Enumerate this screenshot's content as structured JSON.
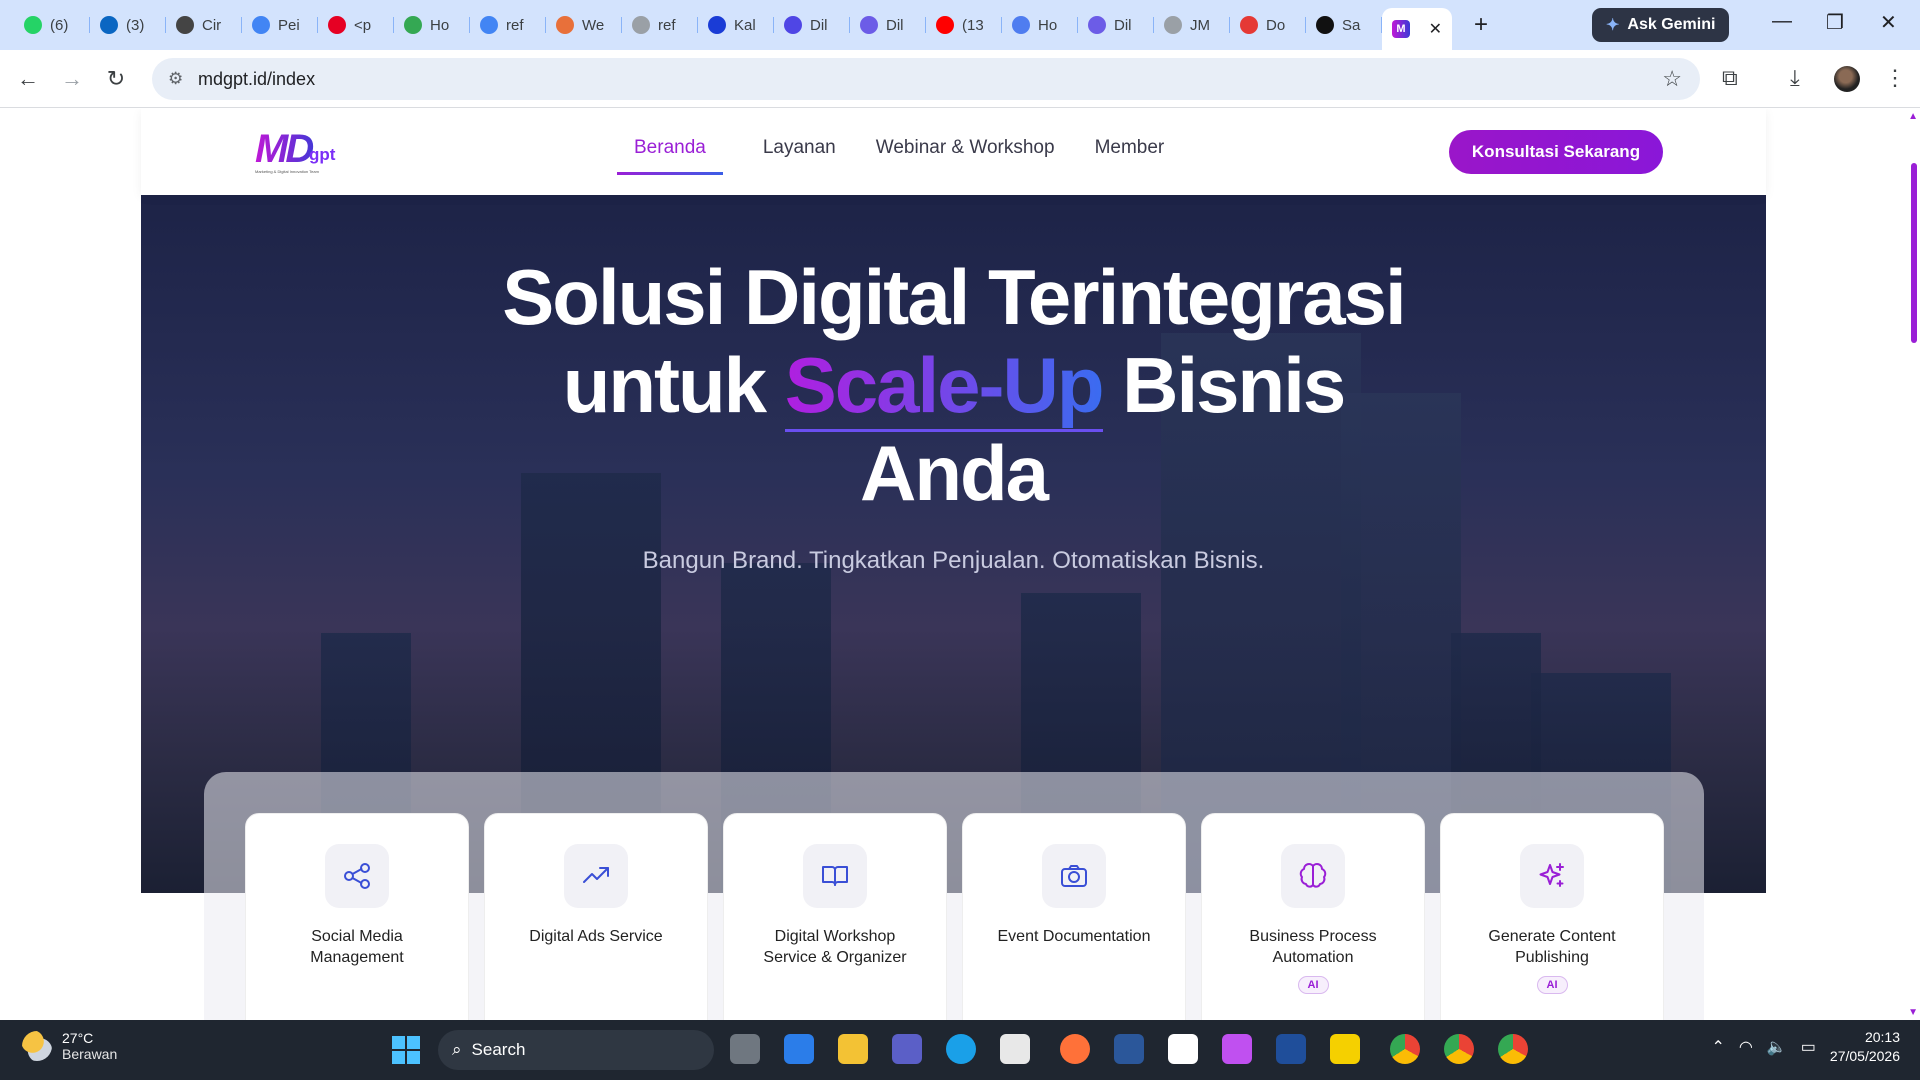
{
  "browser": {
    "tabs": [
      {
        "label": "(6)",
        "color": "#25d366",
        "icon": "whatsapp-icon"
      },
      {
        "label": "(3)",
        "color": "#0a66c2",
        "icon": "linkedin-icon"
      },
      {
        "label": "Cir",
        "color": "#444444",
        "icon": "openai-icon"
      },
      {
        "label": "Pei",
        "color": "#4285f4",
        "icon": "gemini-icon"
      },
      {
        "label": "<p",
        "color": "#e60023",
        "icon": "pinterest-icon"
      },
      {
        "label": "Ho",
        "color": "#34a853",
        "icon": "app-icon"
      },
      {
        "label": "ref",
        "color": "#4285f4",
        "icon": "google-icon"
      },
      {
        "label": "We",
        "color": "#e8703a",
        "icon": "claude-icon"
      },
      {
        "label": "ref",
        "color": "#9aa0a6",
        "icon": "loading-icon"
      },
      {
        "label": "Kal",
        "color": "#1a3cd6",
        "icon": "k-icon"
      },
      {
        "label": "Dil",
        "color": "#4f46e5",
        "icon": "circle-icon"
      },
      {
        "label": "Dil",
        "color": "#6c5ce7",
        "icon": "heart-chat-icon"
      },
      {
        "label": "(13",
        "color": "#ff0000",
        "icon": "youtube-icon"
      },
      {
        "label": "Ho",
        "color": "#4f7df0",
        "icon": "c-icon"
      },
      {
        "label": "Dil",
        "color": "#6c5ce7",
        "icon": "heart-chat-icon"
      },
      {
        "label": "JM",
        "color": "#9aa0a6",
        "icon": "loading-icon"
      },
      {
        "label": "Do",
        "color": "#e53935",
        "icon": "heart-icon"
      },
      {
        "label": "Sa",
        "color": "#111111",
        "icon": "s-icon"
      }
    ],
    "active_tab": {
      "label": "MD",
      "icon": "mdgpt-favicon"
    },
    "new_tab": "+",
    "ask_gemini": "Ask Gemini",
    "url": "mdgpt.id/index"
  },
  "site": {
    "logo_main": "MD",
    "logo_sub": "gpt",
    "logo_tagline": "Marketing & Digital Innovation Team",
    "menu": [
      "Beranda",
      "Layanan",
      "Webinar & Workshop",
      "Member"
    ],
    "cta": "Konsultasi Sekarang",
    "hero": {
      "line1": "Solusi Digital Terintegrasi",
      "line2_pre": "untuk ",
      "line2_highlight": "Scale-Up",
      "line2_post": " Bisnis",
      "line3": "Anda",
      "subtitle": "Bangun Brand.  Tingkatkan Penjualan.  Otomatiskan Bisnis."
    },
    "services": [
      {
        "title": "Social Media Management",
        "icon": "share-icon",
        "badge": ""
      },
      {
        "title": "Digital Ads Service",
        "icon": "trending-up-icon",
        "badge": ""
      },
      {
        "title": "Digital Workshop Service & Organizer",
        "icon": "book-icon",
        "badge": ""
      },
      {
        "title": "Event Documentation",
        "icon": "camera-icon",
        "badge": ""
      },
      {
        "title": "Business Process Automation",
        "icon": "brain-icon",
        "badge": "AI"
      },
      {
        "title": "Generate Content Publishing",
        "icon": "sparkles-icon",
        "badge": "AI"
      }
    ]
  },
  "taskbar": {
    "temperature": "27°C",
    "weather": "Berawan",
    "search_placeholder": "Search",
    "time": "20:13",
    "date": "27/05/2026"
  }
}
